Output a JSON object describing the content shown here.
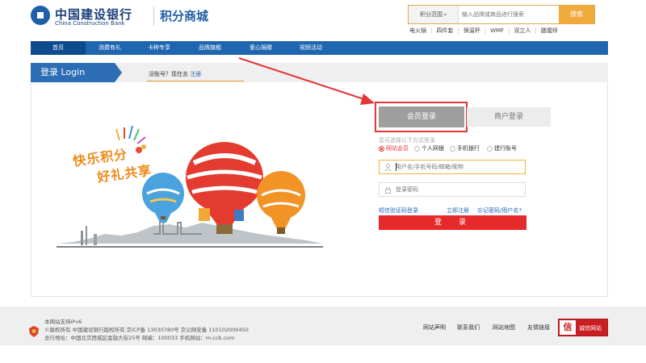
{
  "header": {
    "bank_name_cn": "中国建设银行",
    "bank_name_en": "China Construction Bank",
    "mall_name": "积分商城",
    "search": {
      "scope_label": "积分范围",
      "placeholder": "输入品牌或商品进行搜索",
      "button_label": "搜索"
    },
    "hot_words": [
      "电火锅",
      "四件套",
      "保温杯",
      "WMF",
      "双立人",
      "膳魔师"
    ]
  },
  "nav": {
    "items": [
      {
        "label": "首页",
        "active": true
      },
      {
        "label": "消费有礼",
        "active": false
      },
      {
        "label": "卡种专享",
        "active": false
      },
      {
        "label": "品牌旗舰",
        "active": false
      },
      {
        "label": "爱心捐赠",
        "active": false
      },
      {
        "label": "视频活动",
        "active": false
      }
    ]
  },
  "login_strip": {
    "title": "登录 Login",
    "no_account_text": "没账号？现在去",
    "register_link": "注册"
  },
  "illustration": {
    "slogan_line1": "快乐积分",
    "slogan_line2": "好礼共享"
  },
  "login_form": {
    "tab_member": "会员登录",
    "tab_merchant": "商户登录",
    "choose_hint": "您可选择以下方式登录",
    "options": [
      {
        "label": "网站会员",
        "checked": true
      },
      {
        "label": "个人网银",
        "checked": false
      },
      {
        "label": "手机银行",
        "checked": false
      },
      {
        "label": "建行账号",
        "checked": false
      }
    ],
    "username_placeholder": "用户名/手机号码/邮箱/昵称",
    "password_placeholder": "登录密码",
    "link_sms_login": "短信验证码登录",
    "link_register": "立即注册",
    "link_forgot": "忘记密码/用户名?",
    "login_button": "登　录",
    "colors": {
      "accent_red": "#e6292b",
      "annotation_red": "#e53535",
      "nav_blue": "#1f66b0"
    }
  },
  "footer": {
    "line1": "本网站支持IPv6",
    "line2": "©版权所有 中国建设银行版权所有 京ICP备 13030780号 京公网安备 110102000450",
    "line3": "总行地址：中国北京西城区金融大街25号 邮编：100033 手机网站：m.ccb.com",
    "links": [
      "网站声明",
      "联系我们",
      "网站地图",
      "友情链接"
    ],
    "trust_seal_char": "信",
    "trust_label": "诚信网站"
  }
}
